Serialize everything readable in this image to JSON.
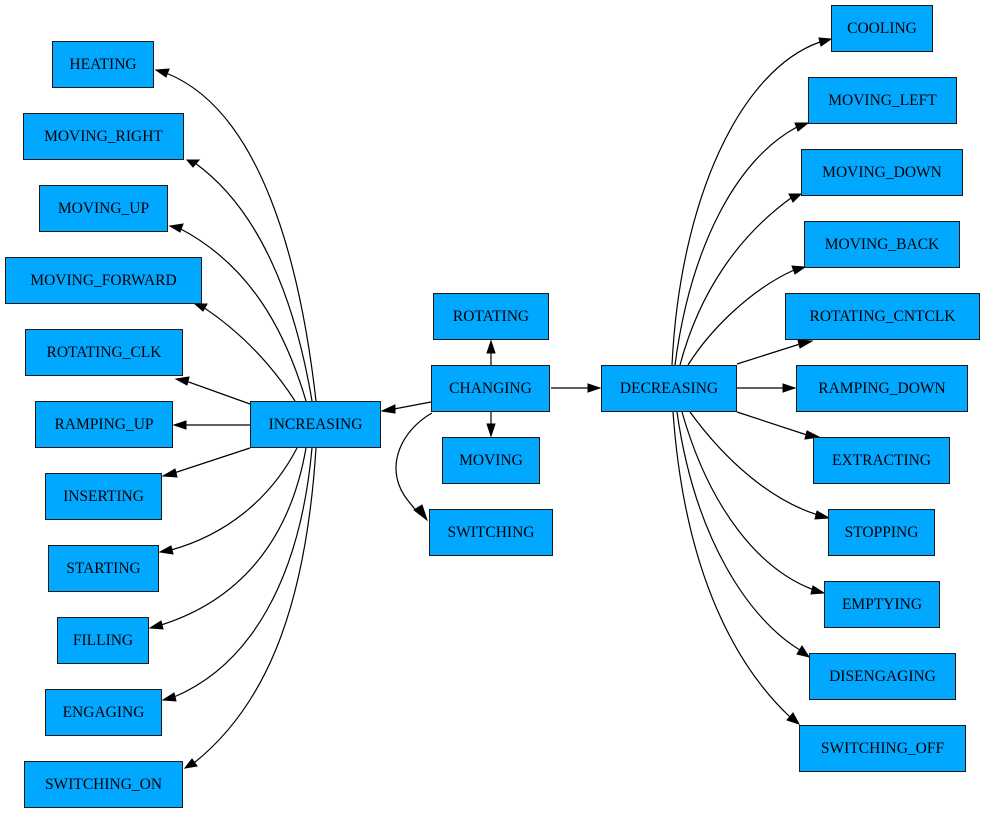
{
  "diagram": {
    "type": "directed-graph",
    "node_fill": "#00a8ff",
    "node_border": "#1a1a1a",
    "edge_color": "#000000",
    "nodes": [
      {
        "id": "CHANGING",
        "label": "CHANGING"
      },
      {
        "id": "ROTATING",
        "label": "ROTATING"
      },
      {
        "id": "MOVING",
        "label": "MOVING"
      },
      {
        "id": "SWITCHING",
        "label": "SWITCHING"
      },
      {
        "id": "INCREASING",
        "label": "INCREASING"
      },
      {
        "id": "DECREASING",
        "label": "DECREASING"
      },
      {
        "id": "HEATING",
        "label": "HEATING"
      },
      {
        "id": "MOVING_RIGHT",
        "label": "MOVING_RIGHT"
      },
      {
        "id": "MOVING_UP",
        "label": "MOVING_UP"
      },
      {
        "id": "MOVING_FORWARD",
        "label": "MOVING_FORWARD"
      },
      {
        "id": "ROTATING_CLK",
        "label": "ROTATING_CLK"
      },
      {
        "id": "RAMPING_UP",
        "label": "RAMPING_UP"
      },
      {
        "id": "INSERTING",
        "label": "INSERTING"
      },
      {
        "id": "STARTING",
        "label": "STARTING"
      },
      {
        "id": "FILLING",
        "label": "FILLING"
      },
      {
        "id": "ENGAGING",
        "label": "ENGAGING"
      },
      {
        "id": "SWITCHING_ON",
        "label": "SWITCHING_ON"
      },
      {
        "id": "COOLING",
        "label": "COOLING"
      },
      {
        "id": "MOVING_LEFT",
        "label": "MOVING_LEFT"
      },
      {
        "id": "MOVING_DOWN",
        "label": "MOVING_DOWN"
      },
      {
        "id": "MOVING_BACK",
        "label": "MOVING_BACK"
      },
      {
        "id": "ROTATING_CNTCLK",
        "label": "ROTATING_CNTCLK"
      },
      {
        "id": "RAMPING_DOWN",
        "label": "RAMPING_DOWN"
      },
      {
        "id": "EXTRACTING",
        "label": "EXTRACTING"
      },
      {
        "id": "STOPPING",
        "label": "STOPPING"
      },
      {
        "id": "EMPTYING",
        "label": "EMPTYING"
      },
      {
        "id": "DISENGAGING",
        "label": "DISENGAGING"
      },
      {
        "id": "SWITCHING_OFF",
        "label": "SWITCHING_OFF"
      }
    ],
    "edges": [
      {
        "from": "CHANGING",
        "to": "ROTATING"
      },
      {
        "from": "CHANGING",
        "to": "MOVING"
      },
      {
        "from": "CHANGING",
        "to": "SWITCHING"
      },
      {
        "from": "CHANGING",
        "to": "INCREASING"
      },
      {
        "from": "CHANGING",
        "to": "DECREASING"
      },
      {
        "from": "INCREASING",
        "to": "HEATING"
      },
      {
        "from": "INCREASING",
        "to": "MOVING_RIGHT"
      },
      {
        "from": "INCREASING",
        "to": "MOVING_UP"
      },
      {
        "from": "INCREASING",
        "to": "MOVING_FORWARD"
      },
      {
        "from": "INCREASING",
        "to": "ROTATING_CLK"
      },
      {
        "from": "INCREASING",
        "to": "RAMPING_UP"
      },
      {
        "from": "INCREASING",
        "to": "INSERTING"
      },
      {
        "from": "INCREASING",
        "to": "STARTING"
      },
      {
        "from": "INCREASING",
        "to": "FILLING"
      },
      {
        "from": "INCREASING",
        "to": "ENGAGING"
      },
      {
        "from": "INCREASING",
        "to": "SWITCHING_ON"
      },
      {
        "from": "DECREASING",
        "to": "COOLING"
      },
      {
        "from": "DECREASING",
        "to": "MOVING_LEFT"
      },
      {
        "from": "DECREASING",
        "to": "MOVING_DOWN"
      },
      {
        "from": "DECREASING",
        "to": "MOVING_BACK"
      },
      {
        "from": "DECREASING",
        "to": "ROTATING_CNTCLK"
      },
      {
        "from": "DECREASING",
        "to": "RAMPING_DOWN"
      },
      {
        "from": "DECREASING",
        "to": "EXTRACTING"
      },
      {
        "from": "DECREASING",
        "to": "STOPPING"
      },
      {
        "from": "DECREASING",
        "to": "EMPTYING"
      },
      {
        "from": "DECREASING",
        "to": "DISENGAGING"
      },
      {
        "from": "DECREASING",
        "to": "SWITCHING_OFF"
      }
    ]
  }
}
